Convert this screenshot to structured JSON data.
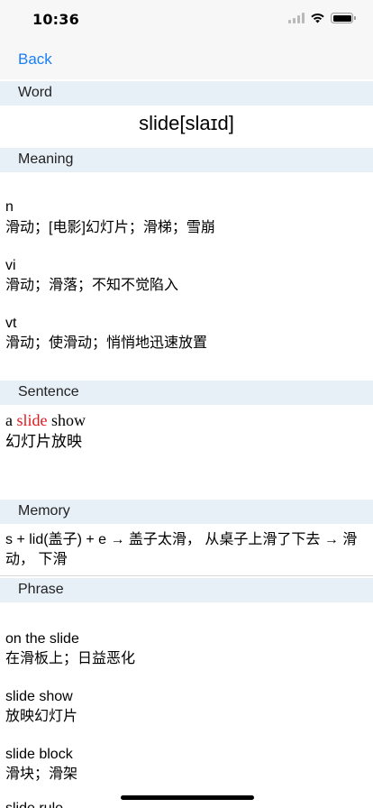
{
  "status": {
    "time": "10:36"
  },
  "nav": {
    "back_label": "Back"
  },
  "sections": {
    "word": "Word",
    "meaning": "Meaning",
    "sentence": "Sentence",
    "memory": "Memory",
    "phrase": "Phrase"
  },
  "word": {
    "headword": "slide[slaɪd]"
  },
  "meanings": [
    {
      "pos": "n",
      "definition": "滑动；[电影]幻灯片；滑梯；雪崩"
    },
    {
      "pos": "vi",
      "definition": "滑动；滑落；不知不觉陷入"
    },
    {
      "pos": "vt",
      "definition": "滑动；使滑动；悄悄地迅速放置"
    }
  ],
  "sentence": {
    "before": "a ",
    "keyword": "slide",
    "after": " show",
    "translation": "幻灯片放映"
  },
  "memory": {
    "text": "s + lid(盖子) + e → 盖子太滑， 从桌子上滑了下去 → 滑动， 下滑"
  },
  "phrases": [
    {
      "phrase": "on the slide",
      "translation": "在滑板上；日益恶化"
    },
    {
      "phrase": "slide show",
      "translation": "放映幻灯片"
    },
    {
      "phrase": "slide block",
      "translation": "滑块；滑架"
    }
  ],
  "clipped_phrase": "slide rule",
  "colors": {
    "accent": "#1a7ef5",
    "section_bg": "#e7eff7",
    "highlight": "#e0181d"
  }
}
